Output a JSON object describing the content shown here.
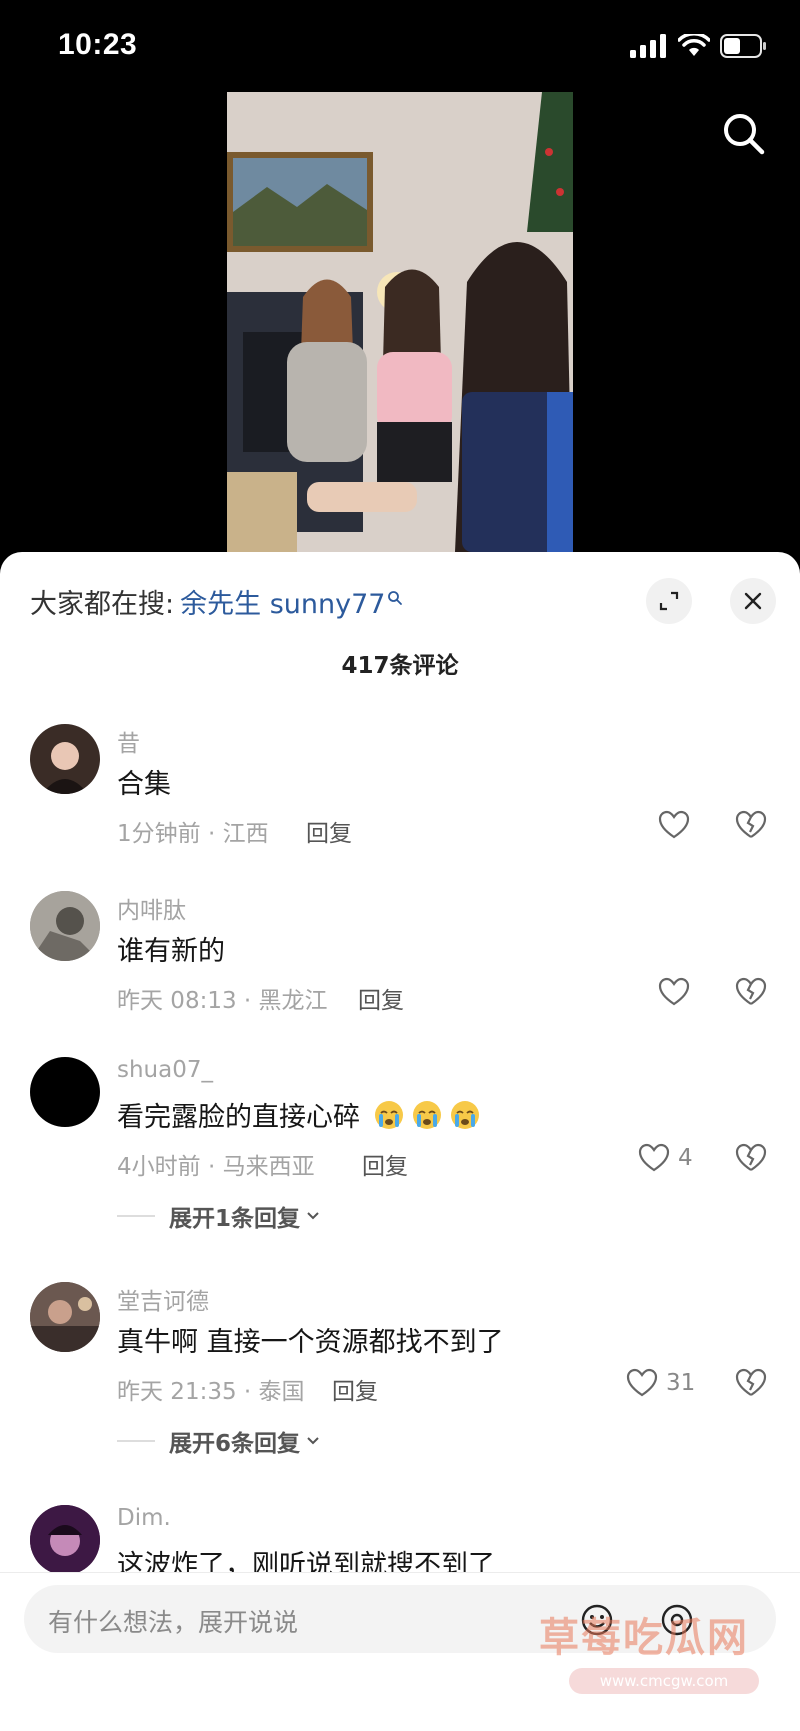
{
  "status": {
    "time": "10:23"
  },
  "sheet": {
    "hot_search_prefix": "大家都在搜:",
    "hot_search_term": "余先生 sunny77",
    "comment_count": "417条评论"
  },
  "comments": [
    {
      "user": "昔",
      "text": "合集",
      "meta": "1分钟前 · 江西",
      "reply": "回复",
      "likes": "",
      "expand": ""
    },
    {
      "user": "内啡肽",
      "text": "谁有新的",
      "meta": "昨天 08:13 · 黑龙江",
      "reply": "回复",
      "likes": "",
      "expand": ""
    },
    {
      "user": "shua07_",
      "text": "看完露脸的直接心碎",
      "meta": "4小时前 · 马来西亚",
      "reply": "回复",
      "likes": "4",
      "expand": "展开1条回复"
    },
    {
      "user": "堂吉诃德",
      "text": "真牛啊 直接一个资源都找不到了",
      "meta": "昨天 21:35 · 泰国",
      "reply": "回复",
      "likes": "31",
      "expand": "展开6条回复"
    },
    {
      "user": "Dim.",
      "text": "这波炸了，刚听说到就搜不到了",
      "meta": "",
      "reply": "",
      "likes": "",
      "expand": ""
    }
  ],
  "input": {
    "placeholder": "有什么想法，展开说说"
  },
  "watermark": {
    "text": "草莓吃瓜网",
    "url": "www.cmcgw.com"
  },
  "colors": {
    "accent_link": "#2c5a9c",
    "sheet_bg": "#ffffff",
    "background": "#000000"
  }
}
